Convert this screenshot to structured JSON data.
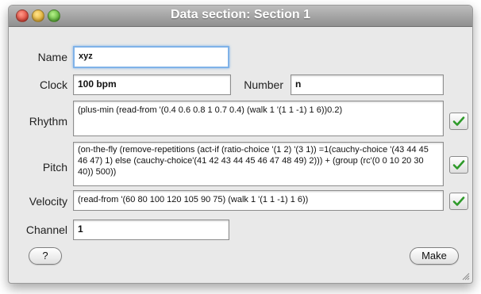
{
  "window": {
    "title": "Data section: Section 1"
  },
  "form": {
    "name_label": "Name",
    "name_value": "xyz",
    "clock_label": "Clock",
    "clock_value": "100 bpm",
    "number_label": "Number",
    "number_value": "n",
    "rhythm_label": "Rhythm",
    "rhythm_value": "(plus-min (read-from '(0.4 0.6 0.8 1 0.7 0.4) (walk 1 '(1 1 -1) 1 6))0.2)",
    "pitch_label": "Pitch",
    "pitch_value": "(on-the-fly (remove-repetitions (act-if (ratio-choice '(1 2) '(3 1)) =1(cauchy-choice '(43 44 45 46 47) 1) else (cauchy-choice'(41 42 43 44 45 46 47 48 49) 2))) + (group (rc'(0 0 10 20 30 40)) 500))",
    "velocity_label": "Velocity",
    "velocity_value": "(read-from '(60 80 100 120 105 90 75) (walk 1 '(1 1 -1) 1 6))",
    "channel_label": "Channel",
    "channel_value": "1"
  },
  "buttons": {
    "help_label": "?",
    "make_label": "Make"
  },
  "icons": {
    "check": "checkmark-icon",
    "resize": "resize-grip-icon"
  },
  "colors": {
    "check_green": "#2e9a2a",
    "focus_ring": "#7fb2e8"
  }
}
